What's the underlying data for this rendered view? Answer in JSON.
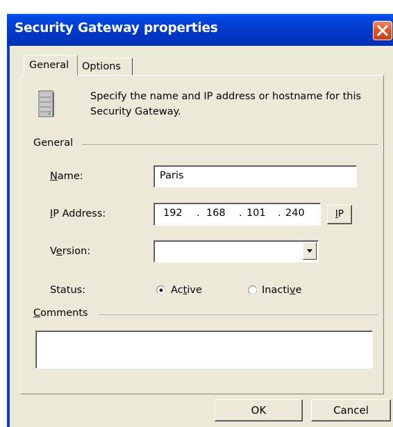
{
  "window": {
    "title": "Security Gateway properties"
  },
  "tabs": [
    {
      "label": "General",
      "active": true
    },
    {
      "label": "Options",
      "active": false
    }
  ],
  "description": "Specify the name and IP address or hostname for this Security Gateway.",
  "general_group": {
    "label": "General"
  },
  "fields": {
    "name": {
      "label_u": "N",
      "label_rest": "ame:",
      "value": "Paris"
    },
    "ip": {
      "label_u": "I",
      "label_rest": "P Address:",
      "octets": [
        "192",
        "168",
        "101",
        "240"
      ],
      "separator": ".",
      "button_u": "I",
      "button_rest": "P"
    },
    "version": {
      "label_pre": "V",
      "label_u": "e",
      "label_rest": "rsion:",
      "value": ""
    },
    "status": {
      "label": "Status:",
      "options": [
        {
          "pre": "Ac",
          "u": "t",
          "rest": "ive",
          "selected": true
        },
        {
          "pre": "Inacti",
          "u": "v",
          "rest": "e",
          "selected": false
        }
      ]
    }
  },
  "comments_group": {
    "label_u": "C",
    "label_rest": "omments",
    "value": ""
  },
  "buttons": {
    "ok": "OK",
    "cancel": "Cancel"
  },
  "icons": {
    "close": "close-icon",
    "server": "server-icon",
    "dropdown": "chevron-down-icon"
  },
  "colors": {
    "title_bar": "#0038c8",
    "close_button": "#e2582e",
    "dialog_bg": "#ece9d8"
  }
}
